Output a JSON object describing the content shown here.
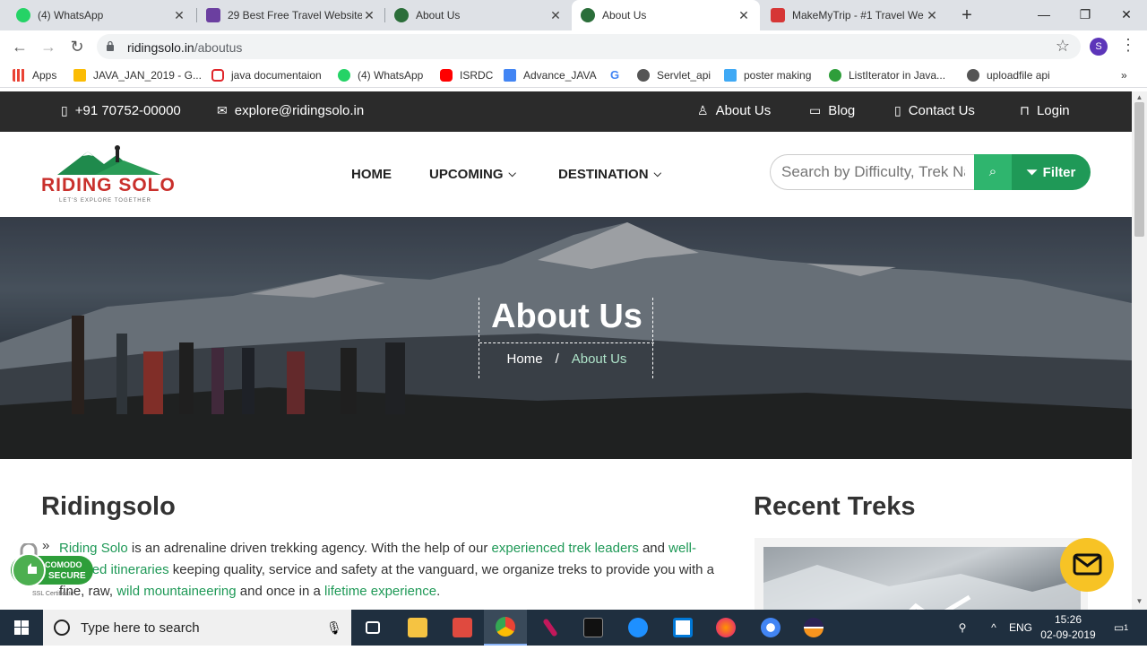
{
  "browser": {
    "tabs": [
      {
        "title": "(4) WhatsApp",
        "favicon": "whatsapp-icon",
        "color": "#25d366"
      },
      {
        "title": "29 Best Free Travel Website",
        "favicon": "colorlib-icon",
        "color": "#6b3fa0"
      },
      {
        "title": "About Us",
        "favicon": "ridingsolo-icon",
        "color": "#2b6e3a"
      },
      {
        "title": "About Us",
        "favicon": "ridingsolo-icon",
        "color": "#2b6e3a"
      },
      {
        "title": "MakeMyTrip - #1 Travel We",
        "favicon": "makemytrip-icon",
        "color": "#d63636"
      }
    ],
    "url_host": "ridingsolo.in",
    "url_path": "/aboutus",
    "profile_initial": "S",
    "bookmarks": [
      {
        "label": "Apps",
        "icon": "apps-grid-icon"
      },
      {
        "label": "JAVA_JAN_2019 - G...",
        "icon": "google-drive-icon"
      },
      {
        "label": "java documentaion",
        "icon": "oracle-icon"
      },
      {
        "label": "(4) WhatsApp",
        "icon": "whatsapp-icon"
      },
      {
        "label": "ISRDC",
        "icon": "youtube-icon"
      },
      {
        "label": "Advance_JAVA",
        "icon": "google-drive-icon"
      },
      {
        "label": "",
        "icon": "google-icon"
      },
      {
        "label": "Servlet_api",
        "icon": "globe-icon"
      },
      {
        "label": "poster making",
        "icon": "poster-icon"
      },
      {
        "label": "ListIterator in Java...",
        "icon": "b-icon"
      },
      {
        "label": "uploadfile api",
        "icon": "globe-icon"
      }
    ]
  },
  "site": {
    "topbar": {
      "phone": "+91 70752-00000",
      "email": "explore@ridingsolo.in",
      "links": [
        "About Us",
        "Blog",
        "Contact Us",
        "Login"
      ]
    },
    "logo_text": "RIDING SOLO",
    "logo_tagline": "LET'S EXPLORE TOGETHER",
    "nav": [
      "HOME",
      "UPCOMING",
      "DESTINATION"
    ],
    "search_placeholder": "Search by Difficulty, Trek Name",
    "filter_label": "Filter",
    "hero": {
      "title": "About Us",
      "crumb_home": "Home",
      "crumb_sep": "/",
      "crumb_current": "About Us"
    },
    "main_heading": "Ridingsolo",
    "para": {
      "p1": "Riding Solo",
      "p2": " is an adrenaline driven trekking agency. With the help of our ",
      "p3": "experienced trek leaders",
      "p4": " and ",
      "p5": "well-planned itineraries",
      "p6": " keeping quality, service and safety at the vanguard, we organize treks to provide you with a fine, raw, ",
      "p7": "wild mountaineering",
      "p8": " and once in a ",
      "p9": "lifetime experience",
      "p10": "."
    },
    "side_heading": "Recent Treks",
    "badge": {
      "brand": "COMODO",
      "secure": "SECURE",
      "caption": "SSL Certificate"
    }
  },
  "taskbar": {
    "search_placeholder": "Type here to search",
    "lang": "ENG",
    "time": "15:26",
    "date": "02-09-2019",
    "notification_count": "1"
  }
}
